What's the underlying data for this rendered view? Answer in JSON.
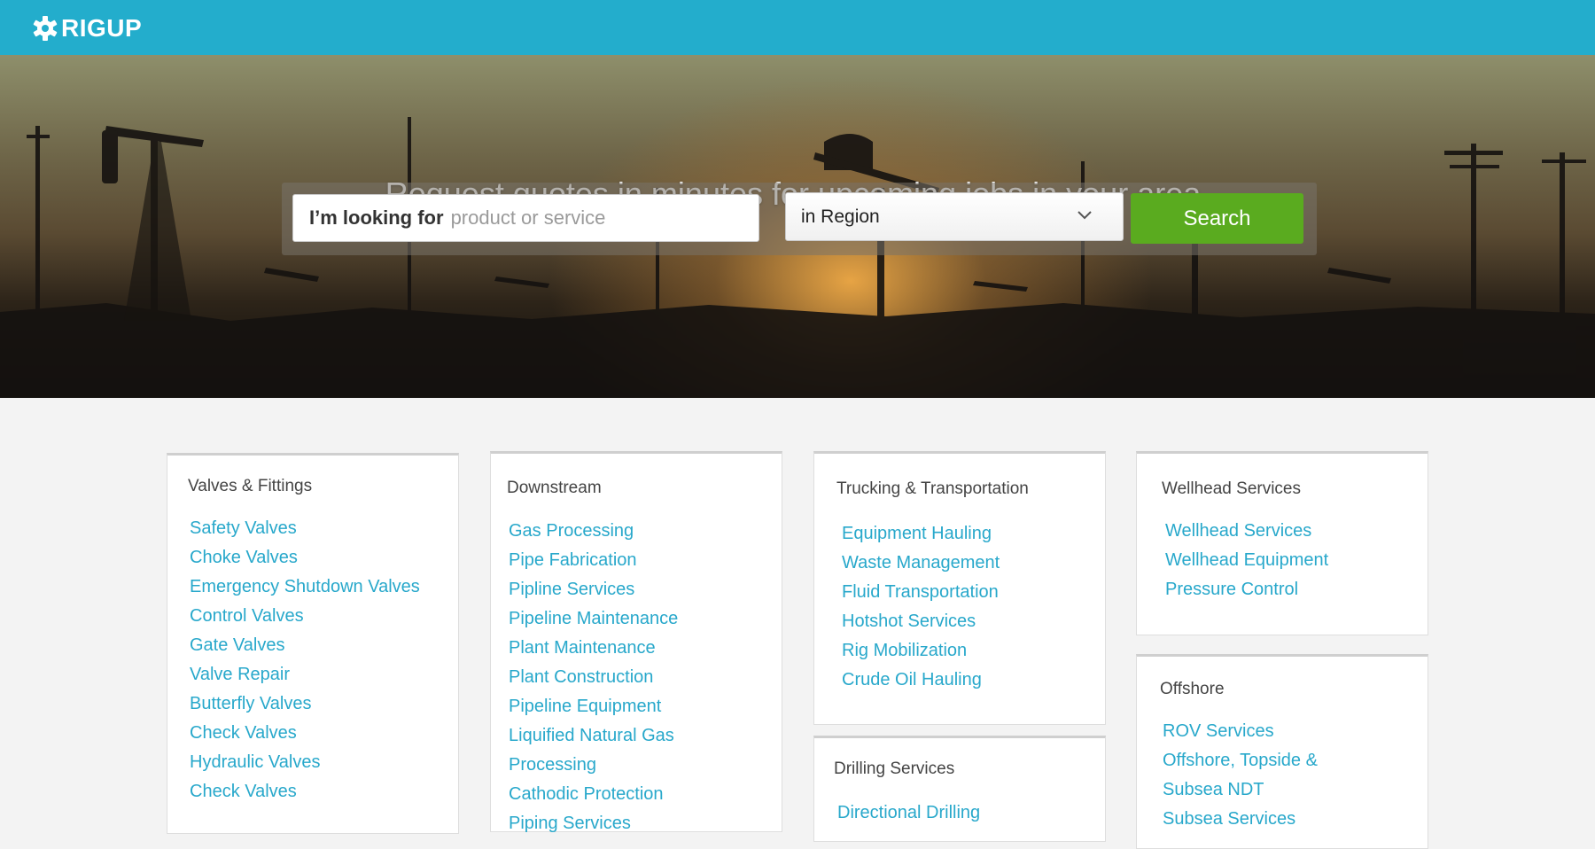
{
  "header": {
    "brand": "RIGUP",
    "logo_icon": "gear-logo-icon",
    "background_color": "#23adcc"
  },
  "hero": {
    "title": "Request quotes in minutes for upcoming jobs in your area.",
    "search": {
      "prefix": "I’m looking for",
      "placeholder": "product or service"
    },
    "region": {
      "selected": "in Region",
      "icon": "chevron-down-icon"
    },
    "search_button": "Search",
    "search_button_color": "#5aab1f"
  },
  "categories": {
    "link_color": "#28a8cb",
    "valves": {
      "title": "Valves & Fittings",
      "items": [
        "Safety Valves",
        "Choke Valves",
        "Emergency Shutdown Valves",
        "Control Valves",
        "Gate Valves",
        "Valve Repair",
        "Butterfly Valves",
        "Check Valves",
        "Hydraulic Valves",
        "Check Valves"
      ]
    },
    "downstream": {
      "title": "Downstream",
      "items": [
        "Gas Processing",
        "Pipe Fabrication",
        "Pipline Services",
        "Pipeline Maintenance",
        "Plant Maintenance",
        "Plant Construction",
        "Pipeline Equipment",
        "Liquified Natural Gas",
        "Processing",
        "Cathodic Protection",
        "Piping Services"
      ]
    },
    "trucking": {
      "title": "Trucking & Transportation",
      "items": [
        "Equipment Hauling",
        "Waste Management",
        "Fluid Transportation",
        "Hotshot Services",
        "Rig Mobilization",
        "Crude Oil Hauling"
      ]
    },
    "drilling": {
      "title": "Drilling Services",
      "items": [
        "Directional Drilling"
      ]
    },
    "wellhead": {
      "title": "Wellhead Services",
      "items": [
        "Wellhead Services",
        "Wellhead Equipment",
        "Pressure Control"
      ]
    },
    "offshore": {
      "title": "Offshore",
      "items": [
        "ROV Services",
        "Offshore, Topside &",
        "Subsea NDT",
        "Subsea Services"
      ]
    }
  }
}
